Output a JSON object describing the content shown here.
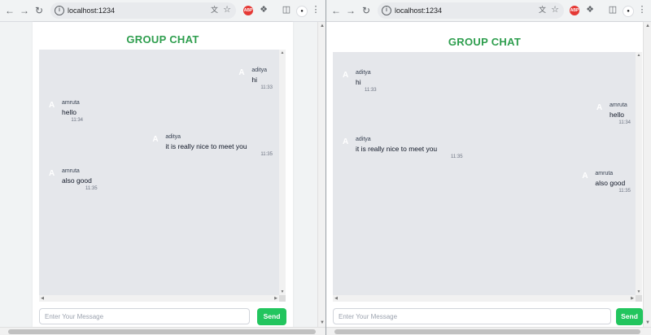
{
  "browser": {
    "url": "localhost:1234",
    "back_icon": "arrow-left",
    "forward_icon": "arrow-right",
    "reload_icon": "reload",
    "abp_label": "ABP"
  },
  "app": {
    "title": "GROUP CHAT",
    "input_placeholder": "Enter Your Message",
    "send_label": "Send",
    "accent_color": "#22c55e",
    "title_color": "#2e9e4e"
  },
  "left_window": {
    "viewer": "aditya",
    "messages": [
      {
        "sender": "aditya",
        "initial": "A",
        "text": "hi",
        "time": "11:33",
        "side": "right"
      },
      {
        "sender": "amruta",
        "initial": "A",
        "text": "hello",
        "time": "11:34",
        "side": "left"
      },
      {
        "sender": "aditya",
        "initial": "A",
        "text": "it is really nice to meet you",
        "time": "11:35",
        "side": "right"
      },
      {
        "sender": "amruta",
        "initial": "A",
        "text": "also good",
        "time": "11:35",
        "side": "left"
      }
    ]
  },
  "right_window": {
    "viewer": "amruta",
    "messages": [
      {
        "sender": "aditya",
        "initial": "A",
        "text": "hi",
        "time": "11:33",
        "side": "left"
      },
      {
        "sender": "amruta",
        "initial": "A",
        "text": "hello",
        "time": "11:34",
        "side": "right"
      },
      {
        "sender": "aditya",
        "initial": "A",
        "text": "it is really nice to meet you",
        "time": "11:35",
        "side": "left"
      },
      {
        "sender": "amruta",
        "initial": "A",
        "text": "also good",
        "time": "11:35",
        "side": "right"
      }
    ]
  }
}
